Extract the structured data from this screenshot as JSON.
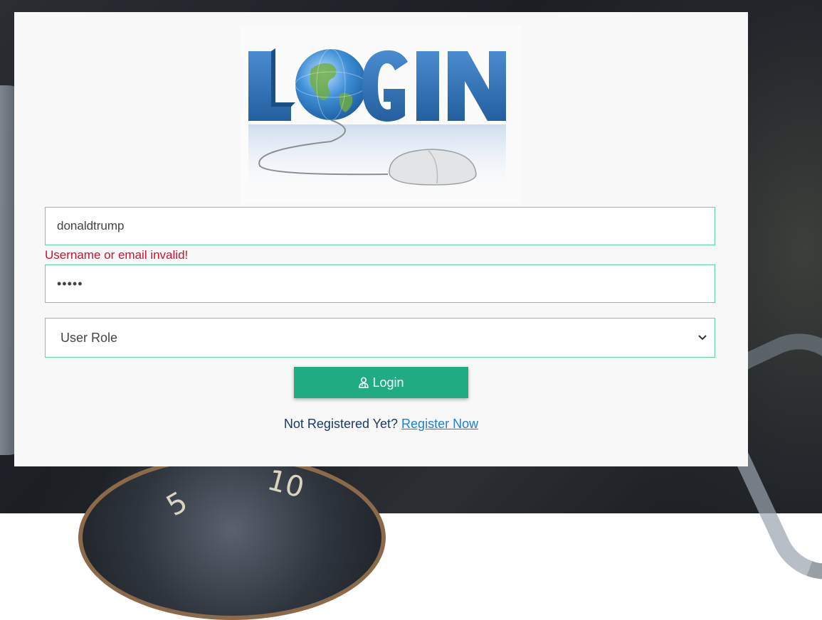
{
  "logo": {
    "text": "LOGIN",
    "colors": {
      "letters": "#2f6fb3",
      "globe": "#3e8fd6"
    }
  },
  "form": {
    "username_value": "donaldtrump",
    "username_error": "Username or email invalid!",
    "password_value": "•••••",
    "role_select_value": "User Role",
    "login_button_label": "Login",
    "register_prompt": "Not Registered Yet?",
    "register_link": "Register Now"
  },
  "icons": {
    "login_button_icon": "user-doctor-icon",
    "select_icon": "chevron-down-icon"
  },
  "colors": {
    "field_border": "#5cd69a",
    "button": "#21ab83",
    "error": "#d0102d",
    "link": "#1e7fd1"
  }
}
